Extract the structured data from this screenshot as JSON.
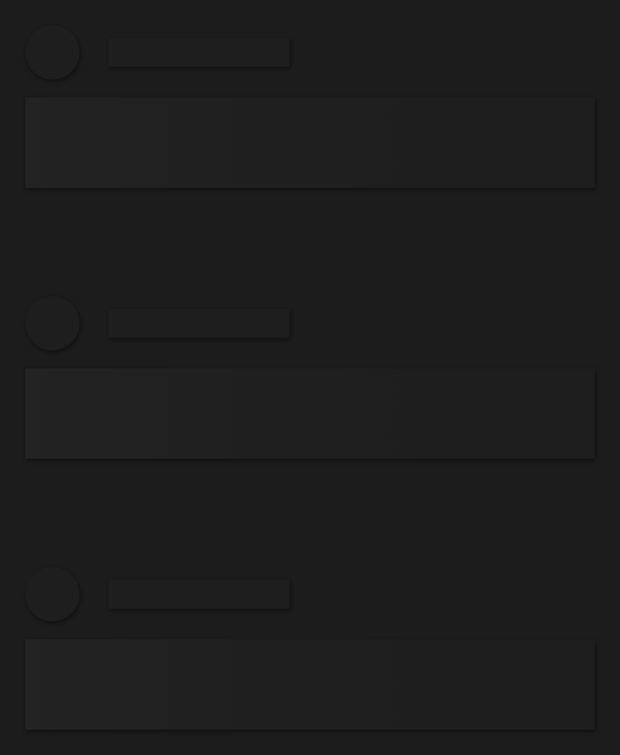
{
  "theme": {
    "background": "#1c1c1c",
    "placeholder": "#1e1e1e"
  },
  "skeleton_items": [
    {
      "avatar": "placeholder",
      "title": "",
      "content": ""
    },
    {
      "avatar": "placeholder",
      "title": "",
      "content": ""
    },
    {
      "avatar": "placeholder",
      "title": "",
      "content": ""
    }
  ]
}
